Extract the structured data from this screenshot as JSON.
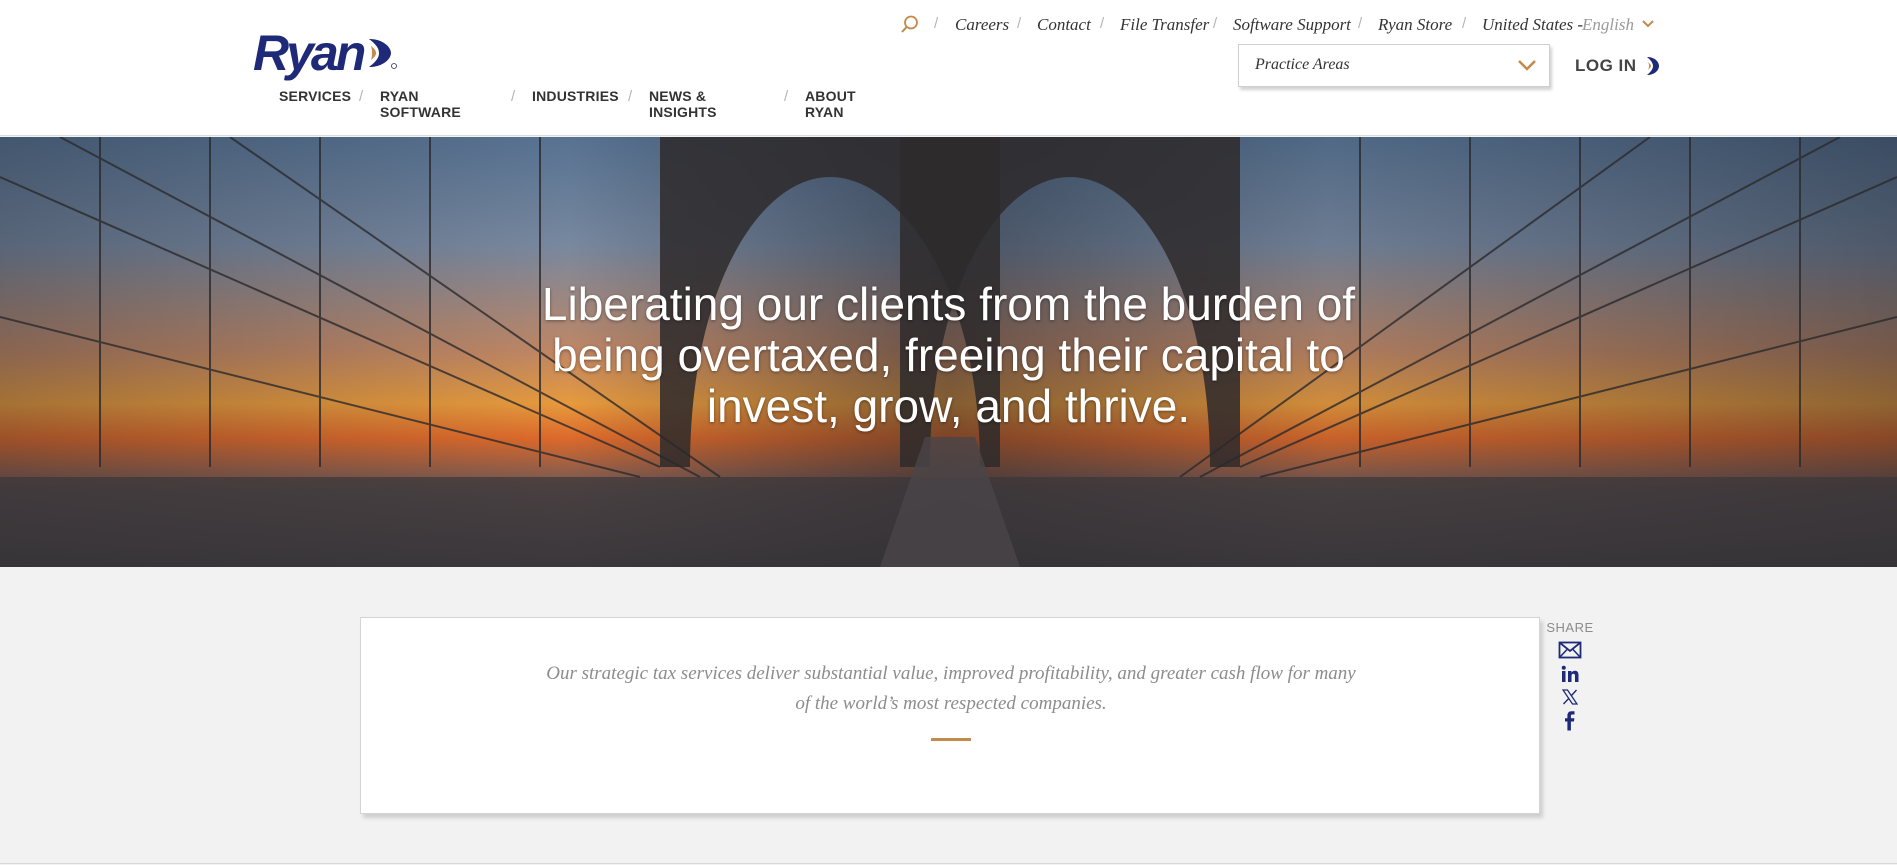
{
  "brand": {
    "name": "Ryan",
    "accent": "#c38a4b",
    "navy": "#1e2a78"
  },
  "utility_nav": {
    "links": [
      "Careers",
      "Contact",
      "File Transfer",
      "Software Support",
      "Ryan Store"
    ],
    "locale_country": "United States -",
    "locale_language": "English",
    "icons": [
      "search-icon",
      "chevron-down-icon"
    ]
  },
  "practice_areas": {
    "label": "Practice Areas"
  },
  "login": {
    "label": "LOG IN"
  },
  "main_nav": [
    "SERVICES",
    "RYAN SOFTWARE",
    "INDUSTRIES",
    "NEWS & INSIGHTS",
    "ABOUT RYAN"
  ],
  "hero": {
    "line1": "Liberating our clients from the burden of",
    "line2": "being overtaxed, freeing their capital to",
    "line3": "invest, grow, and thrive."
  },
  "intro": {
    "line1": "Our strategic tax services deliver substantial value, improved profitability, and greater cash flow for many",
    "line2": "of the world’s most respected companies."
  },
  "share": {
    "label": "SHARE",
    "icons": [
      "email-icon",
      "linkedin-icon",
      "x-icon",
      "facebook-icon"
    ]
  }
}
